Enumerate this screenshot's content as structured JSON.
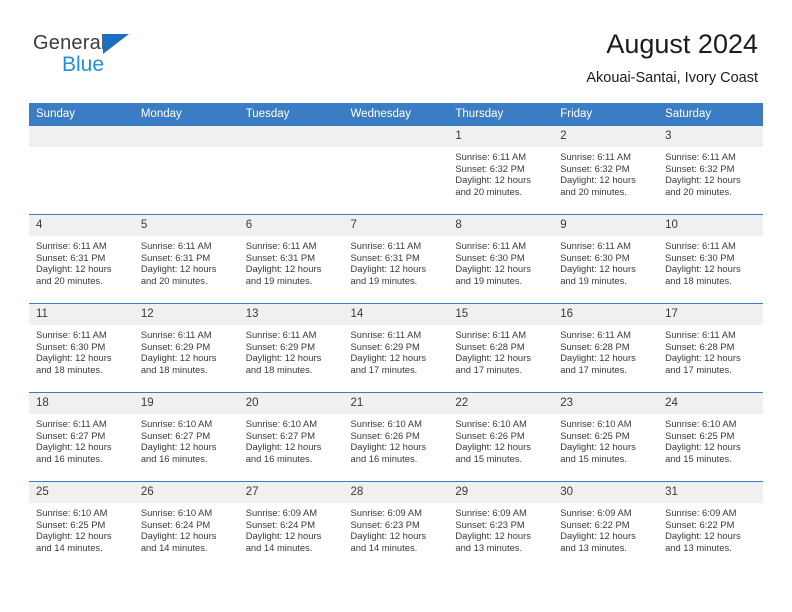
{
  "brand": {
    "name_part1": "General",
    "name_part2": "Blue",
    "accent_color": "#1f8fe0",
    "triangle_color": "#1a6fc4"
  },
  "header": {
    "title": "August 2024",
    "subtitle": "Akouai-Santai, Ivory Coast"
  },
  "calendar": {
    "header_color": "#3b7dc4",
    "weekday_headers": [
      "Sunday",
      "Monday",
      "Tuesday",
      "Wednesday",
      "Thursday",
      "Friday",
      "Saturday"
    ],
    "weeks": [
      [
        {
          "day": "",
          "empty": true
        },
        {
          "day": "",
          "empty": true
        },
        {
          "day": "",
          "empty": true
        },
        {
          "day": "",
          "empty": true
        },
        {
          "day": "1",
          "sunrise": "Sunrise: 6:11 AM",
          "sunset": "Sunset: 6:32 PM",
          "daylight": "Daylight: 12 hours and 20 minutes."
        },
        {
          "day": "2",
          "sunrise": "Sunrise: 6:11 AM",
          "sunset": "Sunset: 6:32 PM",
          "daylight": "Daylight: 12 hours and 20 minutes."
        },
        {
          "day": "3",
          "sunrise": "Sunrise: 6:11 AM",
          "sunset": "Sunset: 6:32 PM",
          "daylight": "Daylight: 12 hours and 20 minutes."
        }
      ],
      [
        {
          "day": "4",
          "sunrise": "Sunrise: 6:11 AM",
          "sunset": "Sunset: 6:31 PM",
          "daylight": "Daylight: 12 hours and 20 minutes."
        },
        {
          "day": "5",
          "sunrise": "Sunrise: 6:11 AM",
          "sunset": "Sunset: 6:31 PM",
          "daylight": "Daylight: 12 hours and 20 minutes."
        },
        {
          "day": "6",
          "sunrise": "Sunrise: 6:11 AM",
          "sunset": "Sunset: 6:31 PM",
          "daylight": "Daylight: 12 hours and 19 minutes."
        },
        {
          "day": "7",
          "sunrise": "Sunrise: 6:11 AM",
          "sunset": "Sunset: 6:31 PM",
          "daylight": "Daylight: 12 hours and 19 minutes."
        },
        {
          "day": "8",
          "sunrise": "Sunrise: 6:11 AM",
          "sunset": "Sunset: 6:30 PM",
          "daylight": "Daylight: 12 hours and 19 minutes."
        },
        {
          "day": "9",
          "sunrise": "Sunrise: 6:11 AM",
          "sunset": "Sunset: 6:30 PM",
          "daylight": "Daylight: 12 hours and 19 minutes."
        },
        {
          "day": "10",
          "sunrise": "Sunrise: 6:11 AM",
          "sunset": "Sunset: 6:30 PM",
          "daylight": "Daylight: 12 hours and 18 minutes."
        }
      ],
      [
        {
          "day": "11",
          "sunrise": "Sunrise: 6:11 AM",
          "sunset": "Sunset: 6:30 PM",
          "daylight": "Daylight: 12 hours and 18 minutes."
        },
        {
          "day": "12",
          "sunrise": "Sunrise: 6:11 AM",
          "sunset": "Sunset: 6:29 PM",
          "daylight": "Daylight: 12 hours and 18 minutes."
        },
        {
          "day": "13",
          "sunrise": "Sunrise: 6:11 AM",
          "sunset": "Sunset: 6:29 PM",
          "daylight": "Daylight: 12 hours and 18 minutes."
        },
        {
          "day": "14",
          "sunrise": "Sunrise: 6:11 AM",
          "sunset": "Sunset: 6:29 PM",
          "daylight": "Daylight: 12 hours and 17 minutes."
        },
        {
          "day": "15",
          "sunrise": "Sunrise: 6:11 AM",
          "sunset": "Sunset: 6:28 PM",
          "daylight": "Daylight: 12 hours and 17 minutes."
        },
        {
          "day": "16",
          "sunrise": "Sunrise: 6:11 AM",
          "sunset": "Sunset: 6:28 PM",
          "daylight": "Daylight: 12 hours and 17 minutes."
        },
        {
          "day": "17",
          "sunrise": "Sunrise: 6:11 AM",
          "sunset": "Sunset: 6:28 PM",
          "daylight": "Daylight: 12 hours and 17 minutes."
        }
      ],
      [
        {
          "day": "18",
          "sunrise": "Sunrise: 6:11 AM",
          "sunset": "Sunset: 6:27 PM",
          "daylight": "Daylight: 12 hours and 16 minutes."
        },
        {
          "day": "19",
          "sunrise": "Sunrise: 6:10 AM",
          "sunset": "Sunset: 6:27 PM",
          "daylight": "Daylight: 12 hours and 16 minutes."
        },
        {
          "day": "20",
          "sunrise": "Sunrise: 6:10 AM",
          "sunset": "Sunset: 6:27 PM",
          "daylight": "Daylight: 12 hours and 16 minutes."
        },
        {
          "day": "21",
          "sunrise": "Sunrise: 6:10 AM",
          "sunset": "Sunset: 6:26 PM",
          "daylight": "Daylight: 12 hours and 16 minutes."
        },
        {
          "day": "22",
          "sunrise": "Sunrise: 6:10 AM",
          "sunset": "Sunset: 6:26 PM",
          "daylight": "Daylight: 12 hours and 15 minutes."
        },
        {
          "day": "23",
          "sunrise": "Sunrise: 6:10 AM",
          "sunset": "Sunset: 6:25 PM",
          "daylight": "Daylight: 12 hours and 15 minutes."
        },
        {
          "day": "24",
          "sunrise": "Sunrise: 6:10 AM",
          "sunset": "Sunset: 6:25 PM",
          "daylight": "Daylight: 12 hours and 15 minutes."
        }
      ],
      [
        {
          "day": "25",
          "sunrise": "Sunrise: 6:10 AM",
          "sunset": "Sunset: 6:25 PM",
          "daylight": "Daylight: 12 hours and 14 minutes."
        },
        {
          "day": "26",
          "sunrise": "Sunrise: 6:10 AM",
          "sunset": "Sunset: 6:24 PM",
          "daylight": "Daylight: 12 hours and 14 minutes."
        },
        {
          "day": "27",
          "sunrise": "Sunrise: 6:09 AM",
          "sunset": "Sunset: 6:24 PM",
          "daylight": "Daylight: 12 hours and 14 minutes."
        },
        {
          "day": "28",
          "sunrise": "Sunrise: 6:09 AM",
          "sunset": "Sunset: 6:23 PM",
          "daylight": "Daylight: 12 hours and 14 minutes."
        },
        {
          "day": "29",
          "sunrise": "Sunrise: 6:09 AM",
          "sunset": "Sunset: 6:23 PM",
          "daylight": "Daylight: 12 hours and 13 minutes."
        },
        {
          "day": "30",
          "sunrise": "Sunrise: 6:09 AM",
          "sunset": "Sunset: 6:22 PM",
          "daylight": "Daylight: 12 hours and 13 minutes."
        },
        {
          "day": "31",
          "sunrise": "Sunrise: 6:09 AM",
          "sunset": "Sunset: 6:22 PM",
          "daylight": "Daylight: 12 hours and 13 minutes."
        }
      ]
    ]
  }
}
